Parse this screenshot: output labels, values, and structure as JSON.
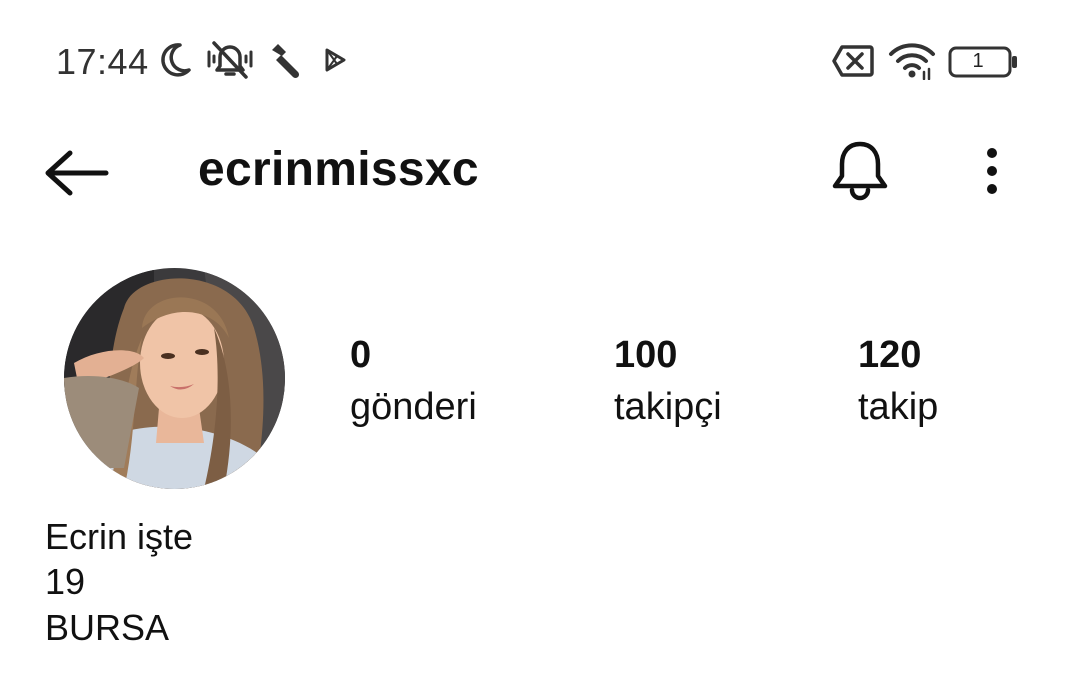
{
  "status_bar": {
    "time": "17:44",
    "icons": [
      "moon-icon",
      "vibrate-off-icon",
      "wrench-icon",
      "play-store-icon",
      "no-sim-icon",
      "wifi-icon",
      "battery-icon"
    ],
    "battery_level": "1"
  },
  "header": {
    "username": "ecrinmissxc",
    "icons": [
      "back-arrow-icon",
      "bell-icon",
      "more-options-icon"
    ]
  },
  "profile": {
    "stats": {
      "posts": {
        "value": "0",
        "label": "gönderi"
      },
      "followers": {
        "value": "100",
        "label": "takipçi"
      },
      "following": {
        "value": "120",
        "label": "takip"
      }
    },
    "bio": {
      "name": "Ecrin işte",
      "line2": "19",
      "line3": "BURSA"
    }
  }
}
